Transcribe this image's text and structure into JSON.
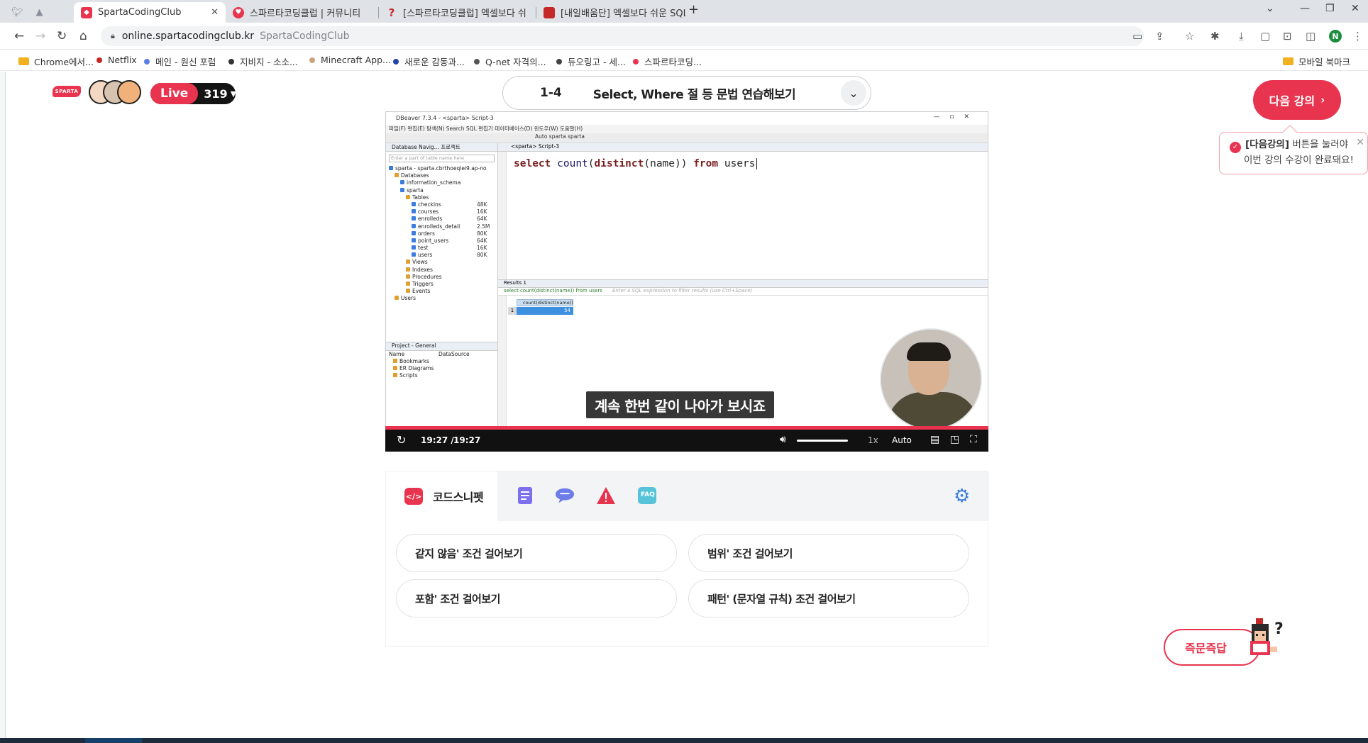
{
  "browser": {
    "tabs": [
      {
        "title": "SpartaCodingClub",
        "favicon_color": "#e8344e",
        "active": true
      },
      {
        "title": "스파르타코딩클럽 | 커뮤니티",
        "favicon_color": "#e8344e",
        "active": false
      },
      {
        "title": "[스파르타코딩클럽] 엑셀보다 쉬",
        "favicon_color": "#c62828",
        "active": false
      },
      {
        "title": "[내일배움단] 엑셀보다 쉬운 SQL",
        "favicon_color": "#c62828",
        "active": false
      }
    ],
    "new_tab": "+",
    "url_host": "online.spartacodingclub.kr",
    "url_site": "SpartaCodingClub",
    "profile_initial": "N",
    "bookmarks": [
      {
        "label": "Chrome에서...",
        "icon": "folder"
      },
      {
        "label": "Netflix",
        "icon": "dot",
        "color": "#c62828"
      },
      {
        "label": "메인 - 원신 포럼",
        "icon": "dot",
        "color": "#5a7ee6"
      },
      {
        "label": "지비지 - 소소...",
        "icon": "dot",
        "color": "#333333"
      },
      {
        "label": "Minecraft App...",
        "icon": "dot",
        "color": "#c9a37a"
      },
      {
        "label": "새로운 감동과...",
        "icon": "dot",
        "color": "#2244aa"
      },
      {
        "label": "Q-net 자격의...",
        "icon": "dot",
        "color": "#555555"
      },
      {
        "label": "듀오링고 - 세...",
        "icon": "dot",
        "color": "#444444"
      },
      {
        "label": "스파르타코딩...",
        "icon": "dot",
        "color": "#e8344e"
      }
    ],
    "mobile_bookmarks": "모바일 북마크"
  },
  "header": {
    "logo_text": "SPARTA",
    "live_label": "Live",
    "live_count": "319",
    "lecture_number": "1-4",
    "lecture_title": "Select, Where 절 등 문법 연습해보기",
    "next_button": "다음 강의",
    "tooltip_bold": "[다음강의]",
    "tooltip_line1_rest": " 버튼을 눌러야",
    "tooltip_line2": "이번 강의 수강이 완료돼요!"
  },
  "video": {
    "app_title": "DBeaver 7.3.4 - <sparta> Script-3",
    "menu": "파일(F)   편집(E)   탐색(N)   Search   SQL 편집기   데이터베이스(D)   윈도우(W)   도움말(H)",
    "toolbar_text": "Auto        sparta        sparta",
    "nav_header": "Database Navig...   프로젝트",
    "filter_placeholder": "Enter a part of table name here",
    "tree": [
      {
        "label": "sparta  - sparta.cbrthoeqlei9.ap-no",
        "indent": 0,
        "color": "#3b7ddd"
      },
      {
        "label": "Databases",
        "indent": 1,
        "color": "#e0a030"
      },
      {
        "label": "information_schema",
        "indent": 2,
        "color": "#3b7ddd"
      },
      {
        "label": "sparta",
        "indent": 2,
        "color": "#3b7ddd"
      },
      {
        "label": "Tables",
        "indent": 3,
        "color": "#e0a030"
      },
      {
        "label": "checkins",
        "indent": 4,
        "color": "#3b7ddd",
        "size": "48K"
      },
      {
        "label": "courses",
        "indent": 4,
        "color": "#3b7ddd",
        "size": "16K"
      },
      {
        "label": "enrolleds",
        "indent": 4,
        "color": "#3b7ddd",
        "size": "64K"
      },
      {
        "label": "enrolleds_detail",
        "indent": 4,
        "color": "#3b7ddd",
        "size": "2.5M"
      },
      {
        "label": "orders",
        "indent": 4,
        "color": "#3b7ddd",
        "size": "80K"
      },
      {
        "label": "point_users",
        "indent": 4,
        "color": "#3b7ddd",
        "size": "64K"
      },
      {
        "label": "test",
        "indent": 4,
        "color": "#3b7ddd",
        "size": "16K"
      },
      {
        "label": "users",
        "indent": 4,
        "color": "#3b7ddd",
        "size": "80K"
      },
      {
        "label": "Views",
        "indent": 3,
        "color": "#e0a030"
      },
      {
        "label": "Indexes",
        "indent": 3,
        "color": "#e0a030"
      },
      {
        "label": "Procedures",
        "indent": 3,
        "color": "#e0a030"
      },
      {
        "label": "Triggers",
        "indent": 3,
        "color": "#e0a030"
      },
      {
        "label": "Events",
        "indent": 3,
        "color": "#e0a030"
      },
      {
        "label": "Users",
        "indent": 1,
        "color": "#e0a030"
      }
    ],
    "project_header": "Project - General",
    "project_col_name": "Name",
    "project_col_source": "DataSource",
    "project_items": [
      "Bookmarks",
      "ER Diagrams",
      "Scripts"
    ],
    "editor_tab": "<sparta> Script-3",
    "sql": {
      "kw1": "select",
      "fn1": "count",
      "p1": "(",
      "kw2": "distinct",
      "p2": "(name)) ",
      "kw3": "from",
      "tbl": " users"
    },
    "results_tab": "Results 1",
    "results_query": "select count(distinct(name)) from users",
    "results_filter_placeholder": "Enter a SQL expression to filter results (use Ctrl+Space)",
    "grid_header": "count(distinct(name))",
    "grid_row_num": "1",
    "grid_value": "54",
    "subtitle": "계속 한번 같이 나아가 보시죠",
    "time_current": "19:27 /",
    "time_total": "19:27",
    "speed": "1x",
    "quality": "Auto",
    "progress_fraction": 1.0
  },
  "panel": {
    "active_tab_label": "코드스니펫",
    "tabs": [
      "notes-icon",
      "chat-icon",
      "warning-icon",
      "faq-icon"
    ],
    "faq_label": "FAQ",
    "snippets": [
      "같지 않음' 조건 걸어보기",
      "범위' 조건 걸어보기",
      "포함' 조건 걸어보기",
      "패턴' (문자열 규칙) 조건 걸어보기"
    ]
  },
  "qa_button": "즉문즉답",
  "colors": {
    "brand": "#e8344e",
    "accent_blue": "#3b7ddd"
  }
}
